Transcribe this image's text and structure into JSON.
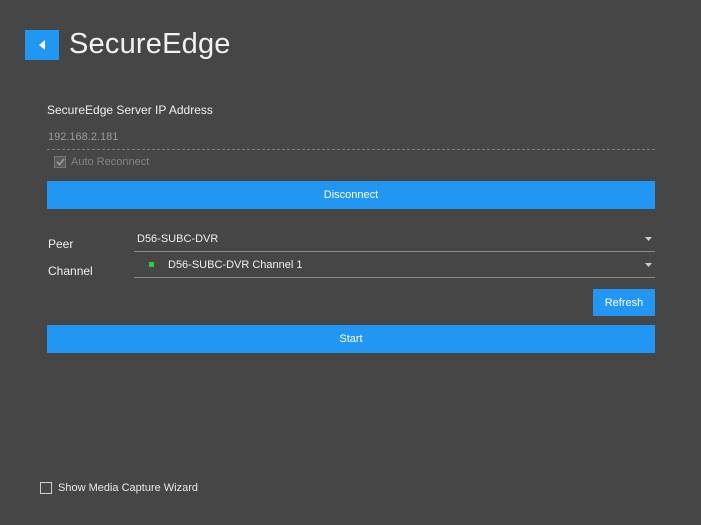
{
  "header": {
    "title": "SecureEdge",
    "back_icon": "chevron-left-icon",
    "accent_color": "#2196f3"
  },
  "server": {
    "label": "SecureEdge Server IP Address",
    "ip_value": "192.168.2.181",
    "auto_reconnect_label": "Auto Reconnect",
    "auto_reconnect_checked": true
  },
  "actions": {
    "disconnect_label": "Disconnect",
    "refresh_label": "Refresh",
    "start_label": "Start"
  },
  "peer": {
    "label": "Peer",
    "selected": "D56-SUBC-DVR"
  },
  "channel": {
    "label": "Channel",
    "selected": "D56-SUBC-DVR Channel 1",
    "status_color": "#2ecc40"
  },
  "footer": {
    "wizard_label": "Show Media Capture Wizard",
    "wizard_checked": false
  }
}
